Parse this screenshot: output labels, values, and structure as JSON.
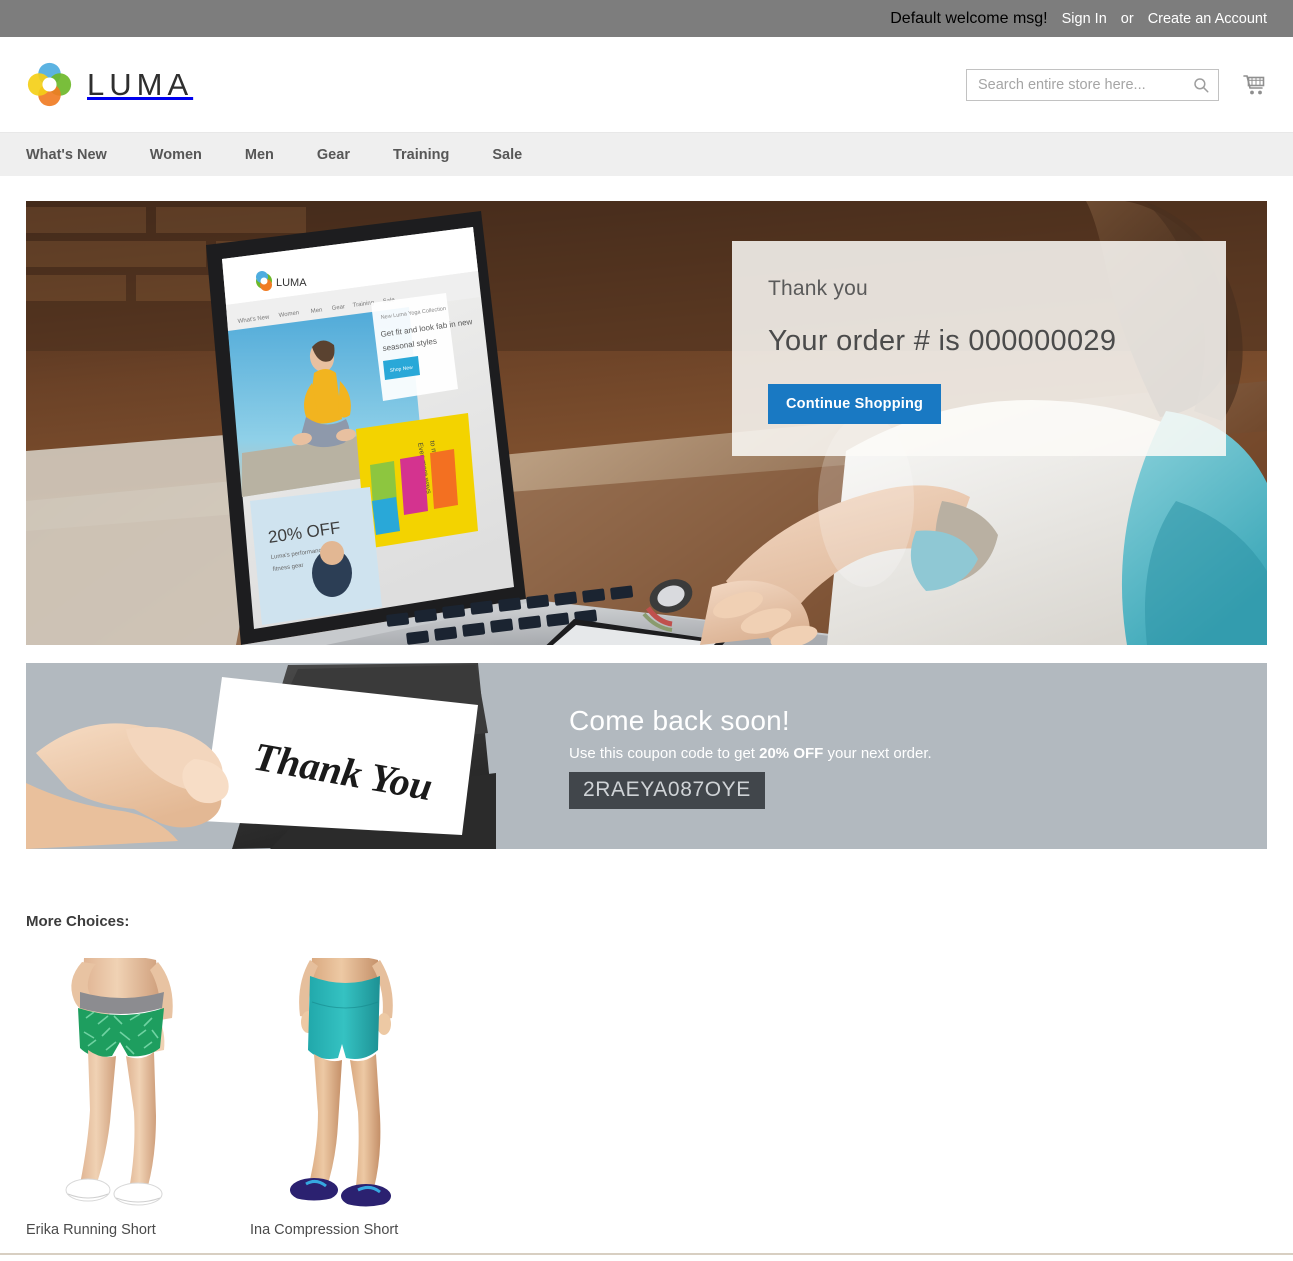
{
  "top_panel": {
    "welcome_message": "Default welcome msg!",
    "sign_in_label": "Sign In",
    "or_label": "or",
    "create_account_label": "Create an Account"
  },
  "header": {
    "logo_text": "LUMA",
    "logo_icon": "luma-flower-logo",
    "search": {
      "placeholder": "Search entire store here...",
      "value": "",
      "icon": "search-icon"
    },
    "cart_icon": "shopping-cart-icon"
  },
  "nav": {
    "items": [
      {
        "label": "What's New"
      },
      {
        "label": "Women"
      },
      {
        "label": "Men"
      },
      {
        "label": "Gear"
      },
      {
        "label": "Training"
      },
      {
        "label": "Sale"
      }
    ]
  },
  "hero": {
    "image_description": "person typing on a laptop showing the Luma storefront, wooden desk",
    "order_panel": {
      "thank_you": "Thank you",
      "order_number_text": "Your order # is 000000029",
      "continue_button": "Continue Shopping"
    }
  },
  "coupon_banner": {
    "image_description": "hand holding a white Thank You card pulled from a dark envelope",
    "title": "Come back soon!",
    "subtitle_prefix": "Use this coupon code to get ",
    "subtitle_highlight": "20% OFF",
    "subtitle_suffix": " your next order.",
    "code": "2RAEYA087OYE"
  },
  "more_choices": {
    "title": "More Choices:",
    "products": [
      {
        "name": "Erika Running Short",
        "image_description": "woman wearing green patterned running shorts with gray waistband and white sneakers"
      },
      {
        "name": "Ina Compression Short",
        "image_description": "woman wearing teal compression shorts with navy blue sneakers"
      }
    ]
  },
  "colors": {
    "top_panel_bg": "#7d7d7d",
    "nav_bg": "#efefef",
    "accent_blue": "#1979c3",
    "banner_bg": "#b2b9bf",
    "coupon_code_bg": "#41464b"
  }
}
